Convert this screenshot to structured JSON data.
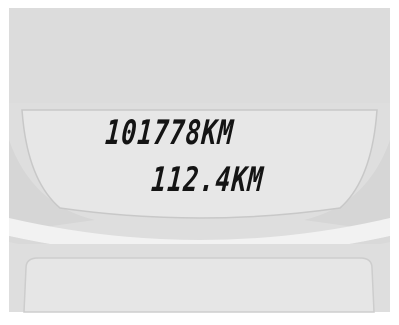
{
  "colors": {
    "panel_background": "#dedede",
    "lcd_background": "#e7e7e7",
    "bezel_highlight": "#f4f4f4",
    "bezel_shadow": "#cfcfcf",
    "segment_text": "#141414"
  },
  "display": {
    "odometer": "101778KM",
    "tripmeter": "112.4KM"
  }
}
